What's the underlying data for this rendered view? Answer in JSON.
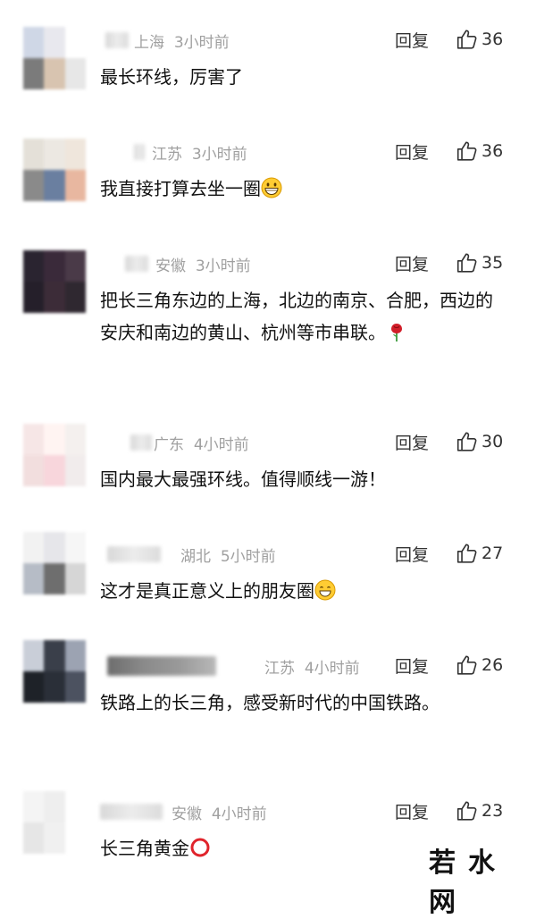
{
  "comments": [
    {
      "region": "上海",
      "time": "3小时前",
      "reply": "回复",
      "likes": "36",
      "text": "最长环线，厉害了"
    },
    {
      "region": "江苏",
      "time": "3小时前",
      "reply": "回复",
      "likes": "36",
      "text": "我直接打算去坐一圈",
      "emoji": "grinning-face-icon"
    },
    {
      "region": "安徽",
      "time": "3小时前",
      "reply": "回复",
      "likes": "35",
      "text": "把长三角东边的上海，北边的南京、合肥，西边的安庆和南边的黄山、杭州等市串联。",
      "emoji": "rose-icon"
    },
    {
      "region": "广东",
      "time": "4小时前",
      "reply": "回复",
      "likes": "30",
      "text": "国内最大最强环线。值得顺线一游！"
    },
    {
      "region": "湖北",
      "time": "5小时前",
      "reply": "回复",
      "likes": "27",
      "text": "这才是真正意义上的朋友圈",
      "emoji": "smiling-face-icon"
    },
    {
      "region": "江苏",
      "time": "4小时前",
      "reply": "回复",
      "likes": "26",
      "text": "铁路上的长三角，感受新时代的中国铁路。"
    },
    {
      "region": "安徽",
      "time": "4小时前",
      "reply": "回复",
      "likes": "23",
      "text": "长三角黄金",
      "emoji": "red-circle-icon"
    }
  ],
  "watermark": "若水网",
  "colors": {
    "meta": "#a0a0a0",
    "text": "#111111",
    "action": "#333333"
  }
}
